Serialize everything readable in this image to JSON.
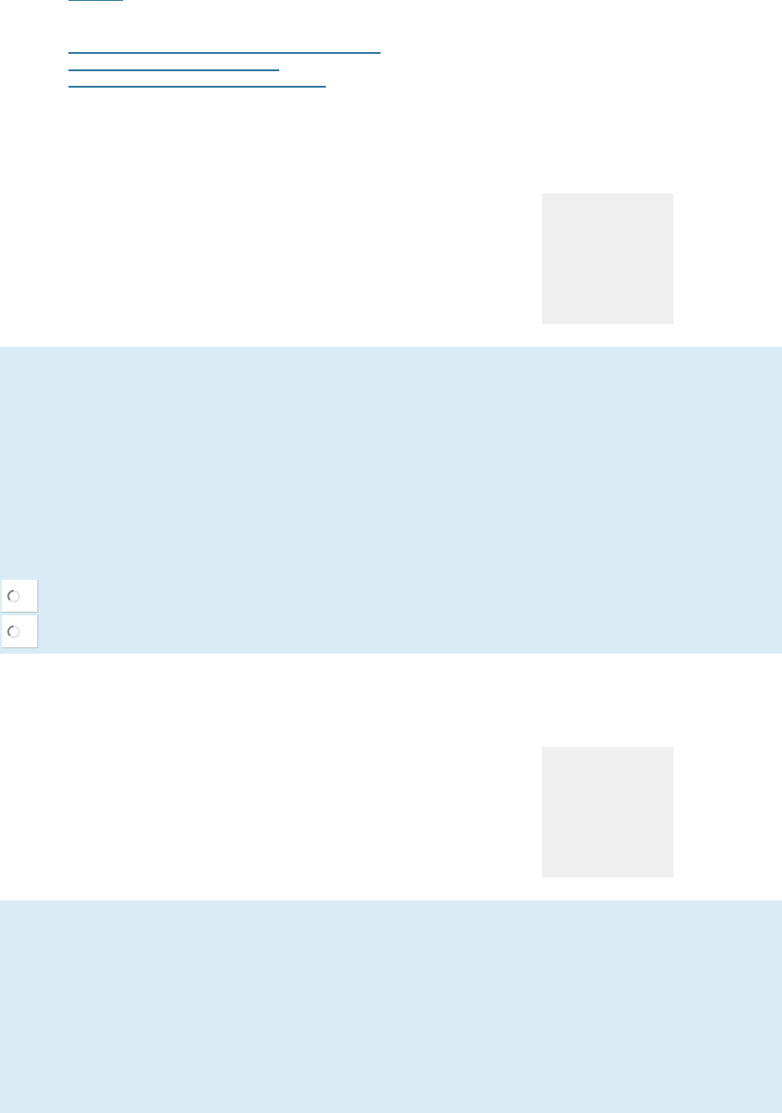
{
  "links": [
    {
      "kind": "link"
    },
    {
      "kind": "link"
    },
    {
      "kind": "link"
    },
    {
      "kind": "link"
    }
  ],
  "sections": [
    {
      "kind": "media"
    },
    {
      "kind": "band",
      "spinners": [
        {
          "kind": "spinner"
        },
        {
          "kind": "spinner"
        }
      ]
    },
    {
      "kind": "media"
    },
    {
      "kind": "band"
    }
  ]
}
